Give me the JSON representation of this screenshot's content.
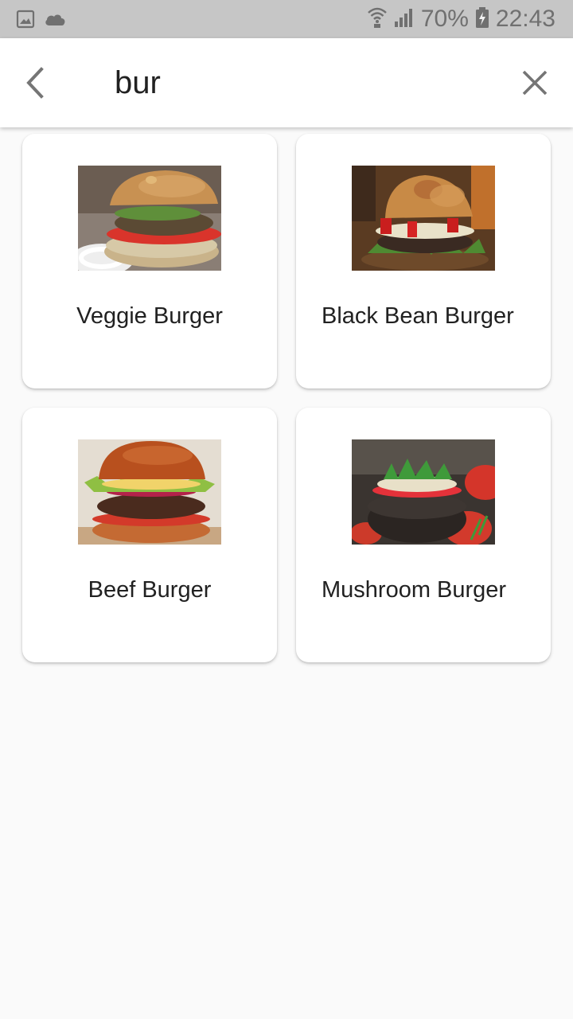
{
  "status_bar": {
    "battery": "70%",
    "time": "22:43",
    "icons": [
      "image-icon",
      "cloud-icon",
      "wifi-icon",
      "signal-icon",
      "battery-charging-icon"
    ]
  },
  "search": {
    "query": "bur",
    "back_icon": "chevron-left-icon",
    "clear_icon": "close-icon"
  },
  "results": [
    {
      "name": "Veggie Burger",
      "image": "veggie-burger-photo"
    },
    {
      "name": "Black Bean Burger",
      "image": "black-bean-burger-photo"
    },
    {
      "name": "Beef Burger",
      "image": "beef-burger-photo"
    },
    {
      "name": "Mushroom Burger",
      "image": "mushroom-burger-photo"
    }
  ],
  "colors": {
    "status_bar_bg": "#c6c6c6",
    "background": "#fafafa",
    "card_bg": "#ffffff",
    "text": "#212121",
    "icon_gray": "#757575"
  }
}
